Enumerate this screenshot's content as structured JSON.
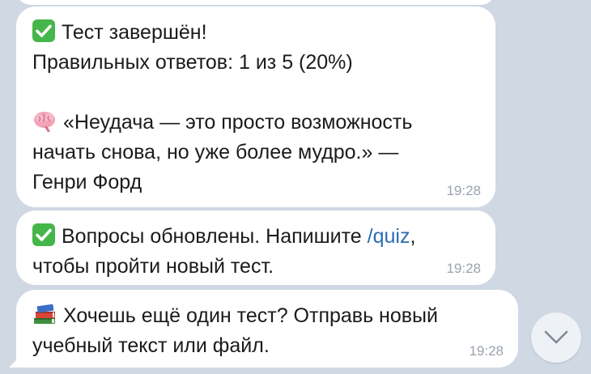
{
  "messages": [
    {
      "line1": "Тест завершён!",
      "line2": "Правильных ответов: 1 из 5 (20%)",
      "quote_line1": "«Неудача — это просто возможность",
      "quote_line2": "начать снова, но уже более мудро.» —",
      "quote_line3": "Генри Форд",
      "time": "19:28"
    },
    {
      "text_before_link": "Вопросы обновлены. Напишите ",
      "link": "/quiz",
      "text_after_link": ",",
      "line2": "чтобы пройти новый тест.",
      "time": "19:28"
    },
    {
      "line1": "Хочешь ещё один тест? Отправь новый",
      "line2": "учебный текст или файл.",
      "time": "19:28"
    }
  ],
  "icons": {
    "check": "check-mark-button-icon",
    "brain": "brain-icon",
    "books": "books-icon",
    "scroll": "chevron-down-icon"
  },
  "colors": {
    "background": "#cfd8e3",
    "bubble": "#ffffff",
    "link": "#2a6db5",
    "check_green": "#45b649"
  }
}
